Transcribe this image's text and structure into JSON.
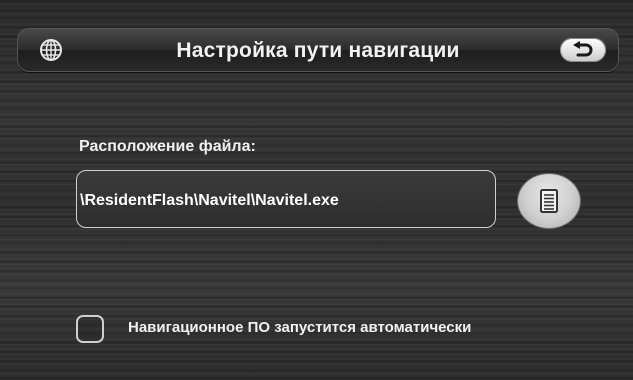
{
  "header": {
    "title": "Настройка пути навигации",
    "left_icon": "globe-icon",
    "back_icon": "back-arrow-icon"
  },
  "file_location": {
    "label": "Расположение файла:",
    "value": "\\ResidentFlash\\Navitel\\Navitel.exe",
    "browse_icon": "document-list-icon"
  },
  "autostart": {
    "label": "Навигационное ПО запустится автоматически",
    "checked": false
  }
}
